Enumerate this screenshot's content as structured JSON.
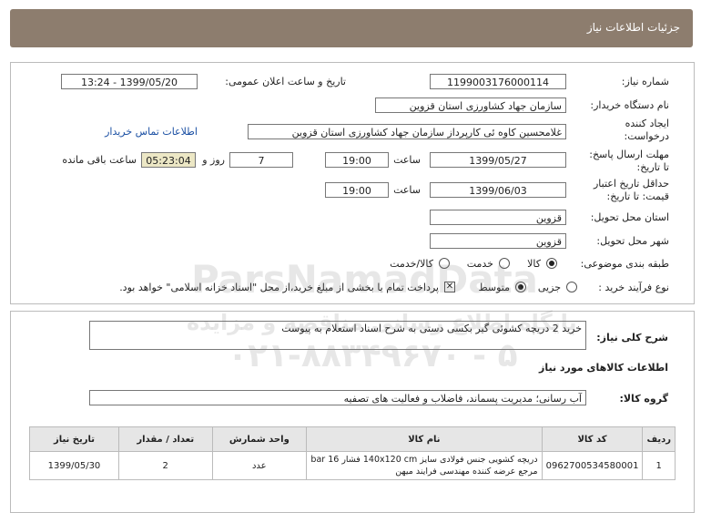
{
  "page": {
    "title": "جزئیات اطلاعات نیاز"
  },
  "details": {
    "need_number_label": "شماره نیاز:",
    "need_number": "1199003176000114",
    "announce_label": "تاریخ و ساعت اعلان عمومی:",
    "announce_value": "1399/05/20 - 13:24",
    "buyer_label": "نام دستگاه خریدار:",
    "buyer_value": "سازمان جهاد کشاورزی استان قزوین",
    "creator_label": "ایجاد کننده درخواست:",
    "creator_value": "غلامحسین کاوه ئی کارپرداز سازمان جهاد کشاورزی استان قزوین",
    "contact_link": "اطلاعات تماس خریدار",
    "deadline_label": "مهلت ارسال پاسخ: تا تاریخ:",
    "deadline_date": "1399/05/27",
    "time_label": "ساعت",
    "deadline_time": "19:00",
    "days_value": "7",
    "days_label": "روز و",
    "remaining_time": "05:23:04",
    "remaining_label": "ساعت باقی مانده",
    "validity_label": "حداقل تاریخ اعتبار قیمت: تا تاریخ:",
    "validity_date": "1399/06/03",
    "validity_time": "19:00",
    "province_label": "استان محل تحویل:",
    "province_value": "قزوین",
    "city_label": "شهر محل تحویل:",
    "city_value": "قزوین",
    "category_label": "طبقه بندی موضوعی:",
    "category_options": [
      "کالا",
      "خدمت",
      "کالا/خدمت"
    ],
    "category_selected": "کالا",
    "process_label": "نوع فرآیند خرید :",
    "process_options": [
      "جزیی",
      "متوسط"
    ],
    "process_selected": "متوسط",
    "payment_note": "پرداخت تمام یا بخشی از مبلغ خرید،از محل \"اسناد خزانه اسلامی\" خواهد بود."
  },
  "summary": {
    "label": "شرح کلی نیاز:",
    "value": "خرید 2 دریچه کشوئی گیر بکسی دستی به شرح اسناد استعلام به پیوست"
  },
  "goods": {
    "section_title": "اطلاعات کالاهای مورد نیاز",
    "group_label": "گروه کالا:",
    "group_value": "آب رسانی؛ مدیریت پسماند، فاضلاب و فعالیت های تصفیه",
    "columns": [
      "ردیف",
      "کد کالا",
      "نام کالا",
      "واحد شمارش",
      "تعداد / مقدار",
      "تاریخ نیاز"
    ],
    "rows": [
      {
        "row": "1",
        "code": "0962700534580001",
        "name": "دریچه کشویی جنس فولادی سایز 140x120 cm فشار 16 bar مرجع عرضه کننده مهندسی فرایند میهن",
        "unit": "عدد",
        "qty": "2",
        "date": "1399/05/30"
      }
    ]
  },
  "watermark": {
    "line1": "ParsNamadData",
    "line2": "پایگاه اطلاع رسانی مناقصه و مزایده",
    "line3": "۰۲۱-۸۸۳۴۹۶۷۰ - ۵"
  }
}
